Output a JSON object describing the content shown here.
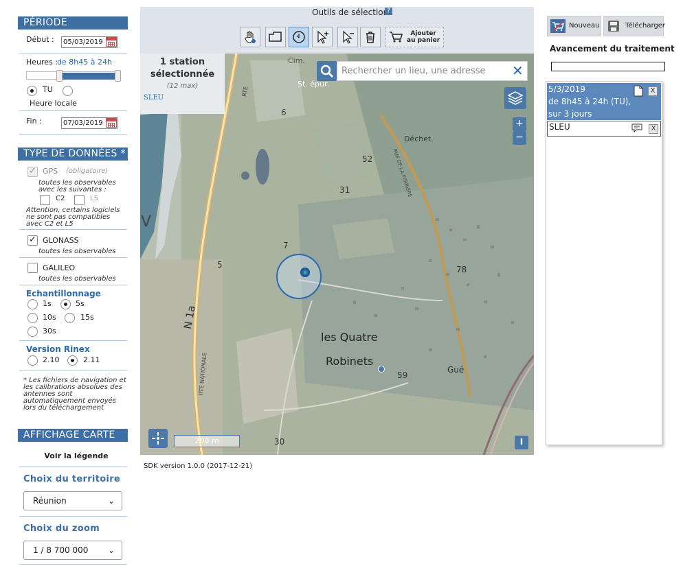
{
  "periode": {
    "header": "PÉRIODE",
    "debut_label": "Début :",
    "debut_value": "05/03/2019",
    "heures_label": "Heures :",
    "heures_value": "de 8h45 à 24h",
    "heures_range_fraction": [
      0.37,
      1.0
    ],
    "tu_label": "TU",
    "heure_locale_label": "Heure locale",
    "fin_label": "Fin :",
    "fin_value": "07/03/2019"
  },
  "type_donnees": {
    "header": "TYPE DE DONNÉES *",
    "gps_label": "GPS",
    "gps_note": "(obligatoire)",
    "gps_sub": "toutes les observables avec les suivantes :",
    "c2_label": "C2",
    "l5_label": "L5",
    "warning": "Attention, certains logiciels ne sont pas compatibles avec C2 et L5",
    "glonass_label": "GLONASS",
    "glonass_sub": "toutes les observables",
    "galileo_label": "GALILEO",
    "galileo_sub": "toutes les observables",
    "echantillonnage_label": "Echantillonnage",
    "sampling_options": [
      "1s",
      "5s",
      "10s",
      "15s",
      "30s"
    ],
    "sampling_selected": "5s",
    "rinex_label": "Version Rinex",
    "rinex_options": [
      "2.10",
      "2.11"
    ],
    "rinex_selected": "2.11",
    "footnote": "* Les fichiers de navigation et les calibrations absolues des antennes sont automatiquement envoyés lors du téléchargement"
  },
  "affichage": {
    "header": "AFFICHAGE CARTE",
    "legend_link": "Voir la légende",
    "territoire_label": "Choix du territoire",
    "territoire_value": "Réunion",
    "zoom_label": "Choix du zoom",
    "zoom_value": "1 / 8 700 000"
  },
  "toolbar": {
    "title": "Outils de sélection",
    "help_icon": "question-icon",
    "add_cart_line1": "Ajouter",
    "add_cart_line2": "au panier"
  },
  "map": {
    "selection_count": "1 station",
    "selection_word": "sélectionnée",
    "selection_max": "(12 max)",
    "station_code": "SLEU",
    "search_placeholder": "Rechercher un lieu, une adresse",
    "scale_label": "200 m",
    "labels": {
      "cim": "Cim.",
      "st_epur": "St. épur.",
      "dechet": "Déchet.",
      "n1a": "N 1a",
      "rte_nationale": "RTE NATIONALE",
      "rte": "RTE",
      "rue_ferriere": "RUE DE LA FERRIERE",
      "quatre": "les Quatre",
      "robinets": "Robinets",
      "gue": "Gué",
      "num_6": "6",
      "num_52": "52",
      "num_31": "31",
      "num_7": "7",
      "num_5": "5",
      "num_78": "78",
      "num_59": "59",
      "num_30": "30",
      "v": "V"
    }
  },
  "right_panel": {
    "nouveau_label": "Nouveau",
    "telecharger_label": "Télécharger",
    "progress_title": "Avancement du traitement",
    "progress_value": 0,
    "cart_date": "5/3/2019",
    "cart_desc": "de 8h45 à 24h (TU), sur 3 jours",
    "cart_station": "SLEU"
  },
  "footer": {
    "sdk_version": "SDK version 1.0.0 (2017-12-21)"
  },
  "colors": {
    "header_blue": "#3d6fa5",
    "link_blue": "#2a6ab0",
    "toolbar_bg": "#dfe4ea",
    "cart_item_bg": "#5b89bd"
  }
}
